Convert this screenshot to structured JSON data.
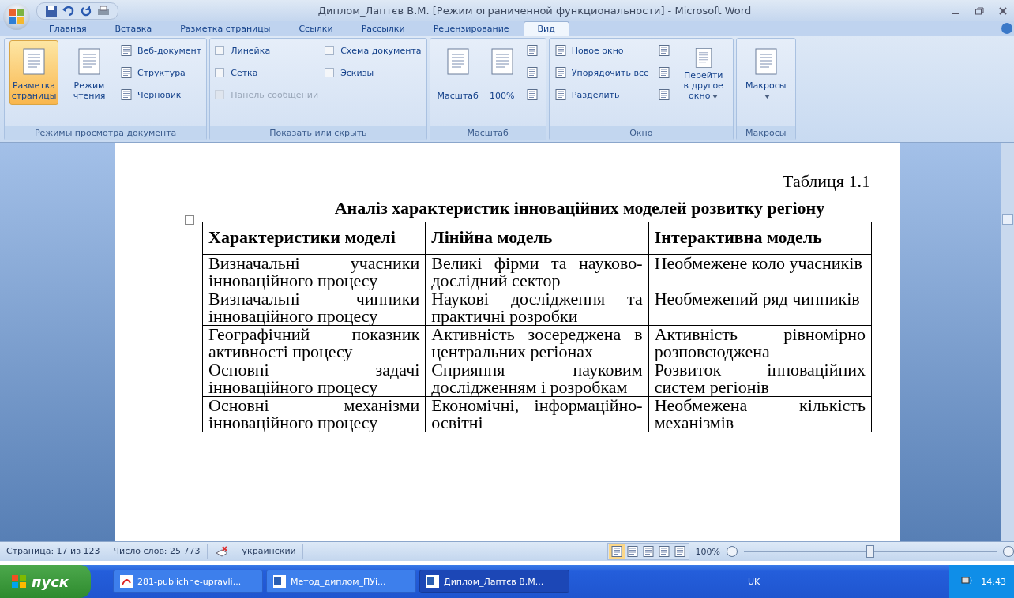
{
  "window": {
    "title": "Диплом_Лаптєв В.М. [Режим ограниченной функциональности] - Microsoft Word"
  },
  "tabs": [
    {
      "label": "Главная",
      "selected": false
    },
    {
      "label": "Вставка",
      "selected": false
    },
    {
      "label": "Разметка страницы",
      "selected": false
    },
    {
      "label": "Ссылки",
      "selected": false
    },
    {
      "label": "Рассылки",
      "selected": false
    },
    {
      "label": "Рецензирование",
      "selected": false
    },
    {
      "label": "Вид",
      "selected": true
    }
  ],
  "ribbon": [
    {
      "label": "Режимы просмотра документа",
      "items": [
        {
          "kind": "large",
          "label": "Разметка страницы",
          "selected": true
        },
        {
          "kind": "large",
          "label": "Режим чтения",
          "selected": false
        },
        {
          "kind": "small",
          "label": "Веб-документ"
        },
        {
          "kind": "small",
          "label": "Структура"
        },
        {
          "kind": "small",
          "label": "Черновик"
        }
      ]
    },
    {
      "label": "Показать или скрыть",
      "items": [
        {
          "kind": "check",
          "label": "Линейка",
          "checked": false,
          "disabled": false
        },
        {
          "kind": "check",
          "label": "Сетка",
          "checked": false,
          "disabled": false
        },
        {
          "kind": "check",
          "label": "Панель сообщений",
          "checked": false,
          "disabled": true
        },
        {
          "kind": "check",
          "label": "Схема документа",
          "checked": false,
          "disabled": false
        },
        {
          "kind": "check",
          "label": "Эскизы",
          "checked": false,
          "disabled": false
        }
      ]
    },
    {
      "label": "Масштаб",
      "items": [
        {
          "kind": "large",
          "label": "Масштаб",
          "selected": false
        },
        {
          "kind": "large",
          "label": "100%",
          "selected": false
        },
        {
          "kind": "icon"
        },
        {
          "kind": "icon"
        },
        {
          "kind": "icon"
        }
      ]
    },
    {
      "label": "Окно",
      "items": [
        {
          "kind": "small",
          "label": "Новое окно"
        },
        {
          "kind": "small",
          "label": "Упорядочить все"
        },
        {
          "kind": "small",
          "label": "Разделить"
        },
        {
          "kind": "icon"
        },
        {
          "kind": "icon"
        },
        {
          "kind": "icon"
        },
        {
          "kind": "large",
          "label": "Перейти в другое окно",
          "selected": false,
          "dropdown": true
        }
      ]
    },
    {
      "label": "Макросы",
      "items": [
        {
          "kind": "large",
          "label": "Макросы",
          "selected": false,
          "dropdown": true
        }
      ]
    }
  ],
  "document": {
    "caption": "Таблиця 1.1",
    "title": "Аналіз характеристик інноваційних моделей розвитку регіону",
    "table": {
      "columns": [
        "Характеристики моделі",
        "Лінійна модель",
        "Інтерактивна модель"
      ],
      "rows": [
        [
          "Визначальні учасники інноваційного процесу",
          "Великі фірми та науково-дослідний сектор",
          "Необмежене коло учасників"
        ],
        [
          "Визначальні чинники інноваційного процесу",
          "Наукові дослідження та практичні розробки",
          "Необмежений ряд чинників"
        ],
        [
          "Географічний показник активності процесу",
          "Активність зосереджена в центральних регіонах",
          "Активність рівномірно розповсюджена"
        ],
        [
          "Основні задачі інноваційного процесу",
          "Сприяння науковим дослідженням і розробкам",
          "Розвиток інноваційних систем регіонів"
        ],
        [
          "Основні механізми інноваційного процесу",
          "Економічні, інформаційно-освітні",
          "Необмежена кількість механізмів"
        ]
      ]
    }
  },
  "status_bar": {
    "items": [
      "Страница: 17 из 123",
      "Число слов: 25 773",
      "украинский"
    ],
    "views": [
      {
        "selected": true
      },
      {
        "selected": false
      },
      {
        "selected": false
      },
      {
        "selected": false
      },
      {
        "selected": false
      }
    ],
    "zoom": "100%",
    "zoom_level": {
      "level": 0.5
    }
  },
  "taskbar": {
    "start": "пуск",
    "tasks": [
      {
        "label": "281-publichne-upravli...",
        "kind": "pdf",
        "selected": false
      },
      {
        "label": "Метод_диплом_ПУі...",
        "kind": "word",
        "selected": false
      },
      {
        "label": "Диплом_Лаптєв В.М...",
        "kind": "word",
        "selected": true
      }
    ],
    "language": "UK",
    "clock": "14:43"
  }
}
